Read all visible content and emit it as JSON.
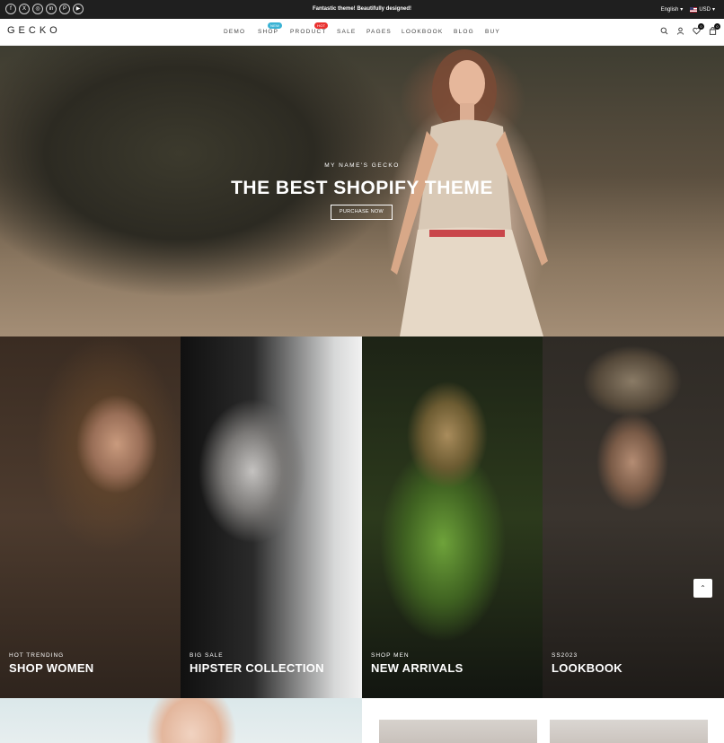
{
  "topbar": {
    "social": [
      "f",
      "X",
      "◎",
      "in",
      "P",
      "▶"
    ],
    "social_icons": [
      "facebook-icon",
      "x-icon",
      "instagram-icon",
      "linkedin-icon",
      "pinterest-icon",
      "youtube-icon"
    ],
    "promo": "Fantastic theme! Beautifully designed!",
    "language": "English",
    "currency": "USD"
  },
  "nav": {
    "logo": "GECKO",
    "menu": [
      "DEMO",
      "SHOP",
      "PRODUCT",
      "SALE",
      "PAGES",
      "LOOKBOOK",
      "BLOG",
      "BUY"
    ],
    "badge_new": "NEW",
    "badge_hot": "HOT",
    "wishlist_count": "0",
    "cart_count": "0",
    "icons": [
      "search-icon",
      "user-icon",
      "heart-icon",
      "bag-icon"
    ]
  },
  "hero": {
    "kicker": "MY NAME'S GECKO",
    "title": "THE BEST SHOPIFY THEME",
    "button": "PURCHASE NOW"
  },
  "tiles": [
    {
      "kicker": "HOT TRENDING",
      "title": "SHOP WOMEN"
    },
    {
      "kicker": "BIG SALE",
      "title": "HIPSTER COLLECTION"
    },
    {
      "kicker": "SHOP MEN",
      "title": "NEW ARRIVALS"
    },
    {
      "kicker": "SS2023",
      "title": "LOOKBOOK"
    }
  ],
  "colors": {
    "topbar": "#1f1f1f",
    "badge_new": "#39b2d4",
    "badge_hot": "#e9312f"
  }
}
